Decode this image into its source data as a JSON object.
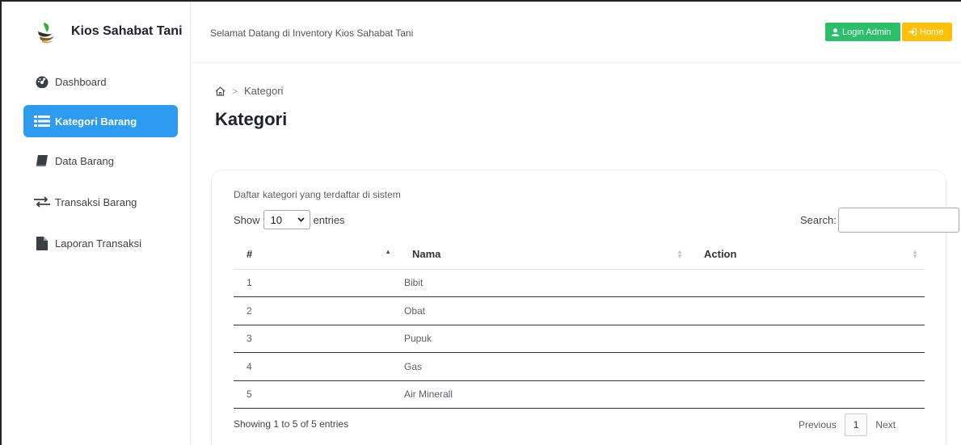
{
  "brand": {
    "title": "Kios Sahabat Tani"
  },
  "sidebar": {
    "items": [
      {
        "label": "Dashboard",
        "icon": "dashboard-icon"
      },
      {
        "label": "Kategori Barang",
        "icon": "list-icon",
        "active": true
      },
      {
        "label": "Data Barang",
        "icon": "book-icon"
      },
      {
        "label": "Transaksi Barang",
        "icon": "exchange-icon"
      },
      {
        "label": "Laporan Transaksi",
        "icon": "file-icon"
      }
    ]
  },
  "topbar": {
    "welcome": "Selamat Datang di Inventory Kios Sahabat Tani",
    "login_label": "Login Admin",
    "home_label": "Home"
  },
  "breadcrumb": {
    "current": "Kategori"
  },
  "page": {
    "title": "Kategori"
  },
  "card": {
    "description": "Daftar kategori yang terdaftar di sistem",
    "length": {
      "show": "Show",
      "value": "10",
      "entries": "entries"
    },
    "search_label": "Search:",
    "columns": [
      "#",
      "Nama",
      "Action"
    ],
    "rows": [
      {
        "no": "1",
        "nama": "Bibit",
        "action": ""
      },
      {
        "no": "2",
        "nama": "Obat",
        "action": ""
      },
      {
        "no": "3",
        "nama": "Pupuk",
        "action": ""
      },
      {
        "no": "4",
        "nama": "Gas",
        "action": ""
      },
      {
        "no": "5",
        "nama": "Air Minerall",
        "action": ""
      }
    ],
    "info": "Showing 1 to 5 of 5 entries",
    "pager": {
      "previous": "Previous",
      "current": "1",
      "next": "Next"
    }
  },
  "colors": {
    "accent": "#2d9cf0",
    "login_button": "#2bbf6a",
    "home_button": "#ffc107"
  }
}
